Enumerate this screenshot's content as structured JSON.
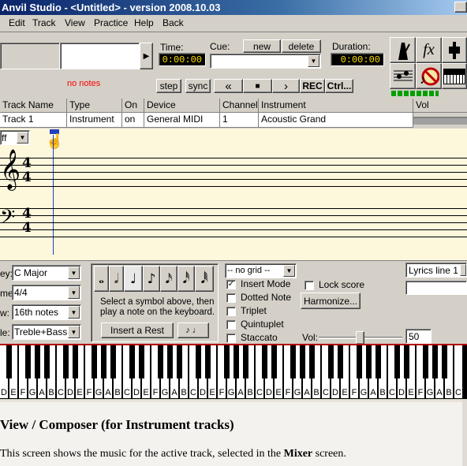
{
  "window": {
    "title": "Anvil Studio - <Untitled> - version 2008.10.03",
    "title_button": "_"
  },
  "menu": [
    "Edit",
    "Track",
    "View",
    "Practice",
    "Help",
    "Back"
  ],
  "transport": {
    "time_label": "Time:",
    "time_value": "0:00:00",
    "cue_label": "Cue:",
    "cue_new": "new",
    "cue_delete": "delete",
    "duration_label": "Duration:",
    "duration_value": "0:00:00",
    "no_notes": "no notes",
    "step": "step",
    "sync": "sync",
    "rewind": "«",
    "stop": "■",
    "play": "›",
    "rec": "REC",
    "ctrl": "Ctrl..."
  },
  "track_table": {
    "headers": [
      "Track Name",
      "Type",
      "On",
      "Device",
      "Channel",
      "Instrument",
      "Vol"
    ],
    "rows": [
      [
        "Track 1",
        "Instrument",
        "on",
        "General MIDI",
        "1",
        "Acoustic Grand",
        ""
      ]
    ]
  },
  "staff": {
    "combo_value": "ff",
    "time_sig_top": "4",
    "time_sig_bottom": "4",
    "treble_clef": "𝄞",
    "bass_clef": "𝄢"
  },
  "settings": {
    "key_label": "ey:",
    "key_value": "C Major",
    "time_label": "me:",
    "time_value": "4/4",
    "view_label": "w:",
    "view_value": "16th notes",
    "staff_label": "le:",
    "staff_value": "Treble+Bass"
  },
  "notes_panel": {
    "help_line1": "Select a symbol above, then",
    "help_line2": "play a note on the keyboard.",
    "insert_rest": "Insert a Rest",
    "tie_symbol": "♪ ♩"
  },
  "options": {
    "grid_value": "-- no grid --",
    "insert_mode": "Insert Mode",
    "insert_mode_checked": true,
    "dotted_note": "Dotted Note",
    "dotted_note_checked": false,
    "triplet": "Triplet",
    "triplet_checked": false,
    "quintuplet": "Quintuplet",
    "quintuplet_checked": false,
    "staccato": "Staccato",
    "staccato_checked": false,
    "lock_score": "Lock score",
    "lock_score_checked": false,
    "harmonize": "Harmonize...",
    "vol_label": "Vol:",
    "vol_value": "50",
    "lyrics_value": "Lyrics line 1",
    "lyrics_text": ""
  },
  "keyboard": {
    "white_labels": [
      "D",
      "E",
      "F",
      "G",
      "A",
      "B",
      "C",
      "D",
      "E",
      "F",
      "G",
      "A",
      "B",
      "C",
      "D",
      "E",
      "F",
      "G",
      "A",
      "B",
      "C",
      "D",
      "E",
      "F",
      "G",
      "A",
      "B",
      "C",
      "D",
      "E",
      "F",
      "G",
      "A",
      "B",
      "C",
      "D",
      "E",
      "F",
      "G",
      "A",
      "B",
      "C",
      "D",
      "E",
      "F",
      "G",
      "A",
      "B",
      "C"
    ]
  },
  "doc": {
    "heading": "View / Composer (for Instrument tracks)",
    "body_prefix": "This screen shows the music for the active track, selected in the ",
    "body_bold": "Mixer",
    "body_suffix": " screen."
  },
  "colors": {
    "staff_bg": "#fdf7dc",
    "lcd_text": "#ffe000",
    "no_notes": "#ff0000",
    "title_start": "#0a246a"
  }
}
